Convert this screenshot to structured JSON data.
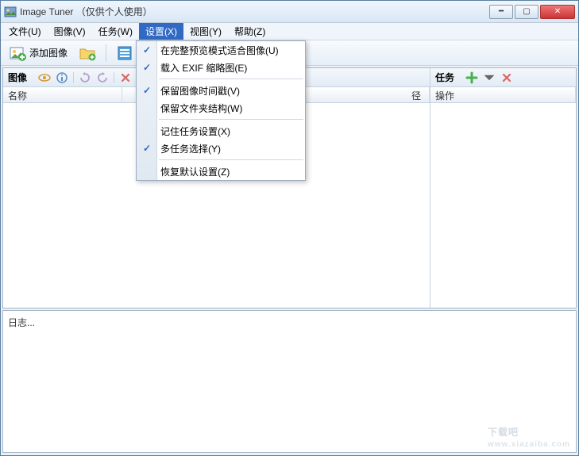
{
  "window": {
    "title": "Image Tuner （仅供个人使用）"
  },
  "menubar": {
    "file": "文件(U)",
    "image": "图像(V)",
    "task": "任务(W)",
    "settings": "设置(X)",
    "view": "视图(Y)",
    "help": "帮助(Z)"
  },
  "toolbar": {
    "add_images": "添加图像"
  },
  "dropdown": {
    "fit_preview": "在完整预览模式适合图像(U)",
    "load_exif": "载入 EXIF 缩略图(E)",
    "keep_timestamp": "保留图像时间戳(V)",
    "keep_folder": "保留文件夹结构(W)",
    "remember_task": "记住任务设置(X)",
    "multi_select": "多任务选择(Y)",
    "restore_defaults": "恢复默认设置(Z)"
  },
  "left_panel": {
    "title": "图像",
    "col_name": "名称",
    "col_path": "径"
  },
  "right_panel": {
    "title": "任务",
    "col_action": "操作"
  },
  "log": {
    "text": "日志..."
  },
  "watermark": {
    "main": "下载吧",
    "sub": "www.xiazaiba.com"
  }
}
